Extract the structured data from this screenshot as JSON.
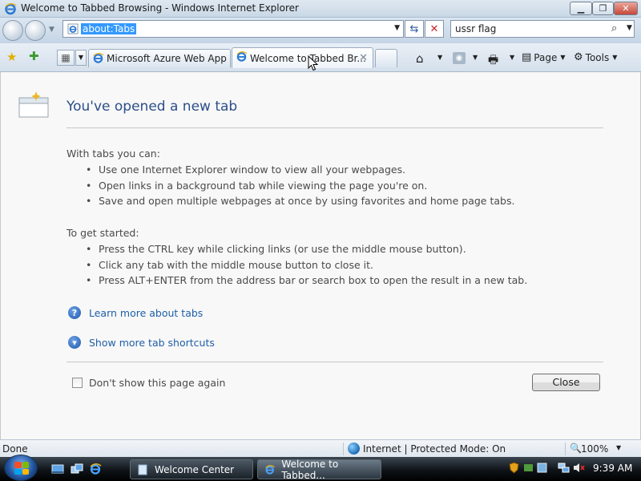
{
  "window": {
    "title": "Welcome to Tabbed Browsing - Windows Internet Explorer"
  },
  "navbar": {
    "address": "about:Tabs",
    "search_value": "ussr flag"
  },
  "tabs": [
    {
      "label": "Microsoft Azure Web App ..."
    },
    {
      "label": "Welcome to Tabbed Br..."
    }
  ],
  "command_bar": {
    "page_label": "Page",
    "tools_label": "Tools"
  },
  "content": {
    "heading": "You've opened a new tab",
    "intro_1": "With tabs you can:",
    "bullets_1": [
      "Use one Internet Explorer window to view all your webpages.",
      "Open links in a background tab while viewing the page you're on.",
      "Save and open multiple webpages at once by using favorites and home page tabs."
    ],
    "intro_2": "To get started:",
    "bullets_2": [
      "Press the CTRL key while clicking links (or use the middle mouse button).",
      "Click any tab with the middle mouse button to close it.",
      "Press ALT+ENTER from the address bar or search box to open the result in a new tab."
    ],
    "learn_more": "Learn more about tabs",
    "show_shortcuts": "Show more tab shortcuts",
    "dont_show": "Don't show this page again",
    "close_label": "Close"
  },
  "statusbar": {
    "status": "Done",
    "zone": "Internet | Protected Mode: On",
    "zoom": "100%"
  },
  "taskbar": {
    "buttons": [
      {
        "label": "Welcome Center"
      },
      {
        "label": "Welcome to Tabbed..."
      }
    ],
    "clock": "9:39 AM"
  }
}
